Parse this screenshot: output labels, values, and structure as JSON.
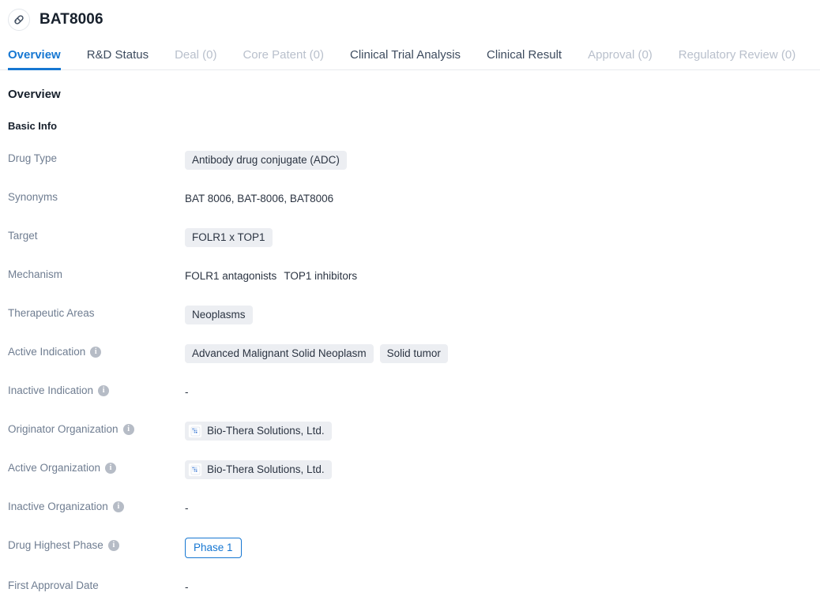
{
  "header": {
    "icon": "pill-capsule-icon",
    "title": "BAT8006"
  },
  "tabs": [
    {
      "label": "Overview",
      "state": "active"
    },
    {
      "label": "R&D Status",
      "state": "enabled"
    },
    {
      "label": "Deal (0)",
      "state": "disabled"
    },
    {
      "label": "Core Patent (0)",
      "state": "disabled"
    },
    {
      "label": "Clinical Trial Analysis",
      "state": "enabled"
    },
    {
      "label": "Clinical Result",
      "state": "enabled"
    },
    {
      "label": "Approval (0)",
      "state": "disabled"
    },
    {
      "label": "Regulatory Review (0)",
      "state": "disabled"
    }
  ],
  "overview": {
    "section_title": "Overview",
    "group_title": "Basic Info",
    "labels": {
      "drug_type": "Drug Type",
      "synonyms": "Synonyms",
      "target": "Target",
      "mechanism": "Mechanism",
      "therapeutic_areas": "Therapeutic Areas",
      "active_indication": "Active Indication",
      "inactive_indication": "Inactive Indication",
      "originator_organization": "Originator Organization",
      "active_organization": "Active Organization",
      "inactive_organization": "Inactive Organization",
      "drug_highest_phase": "Drug Highest Phase",
      "first_approval_date": "First Approval Date"
    },
    "values": {
      "drug_type": "Antibody drug conjugate (ADC)",
      "synonyms": "BAT 8006,  BAT-8006,  BAT8006",
      "target": "FOLR1 x TOP1",
      "mechanism_1": "FOLR1 antagonists",
      "mechanism_2": "TOP1 inhibitors",
      "therapeutic_areas": "Neoplasms",
      "active_indication_1": "Advanced Malignant Solid Neoplasm",
      "active_indication_2": "Solid tumor",
      "inactive_indication": "-",
      "originator_organization": "Bio-Thera Solutions, Ltd.",
      "active_organization": "Bio-Thera Solutions, Ltd.",
      "inactive_organization": "-",
      "drug_highest_phase": "Phase 1",
      "first_approval_date": "-"
    },
    "info_icon_glyph": "i"
  },
  "colors": {
    "accent": "#1677d2",
    "label": "#6f7d91",
    "value": "#2b3442",
    "tag_bg": "#eceef2",
    "tab_disabled": "#b9c0cc",
    "border": "#e8eaee"
  }
}
